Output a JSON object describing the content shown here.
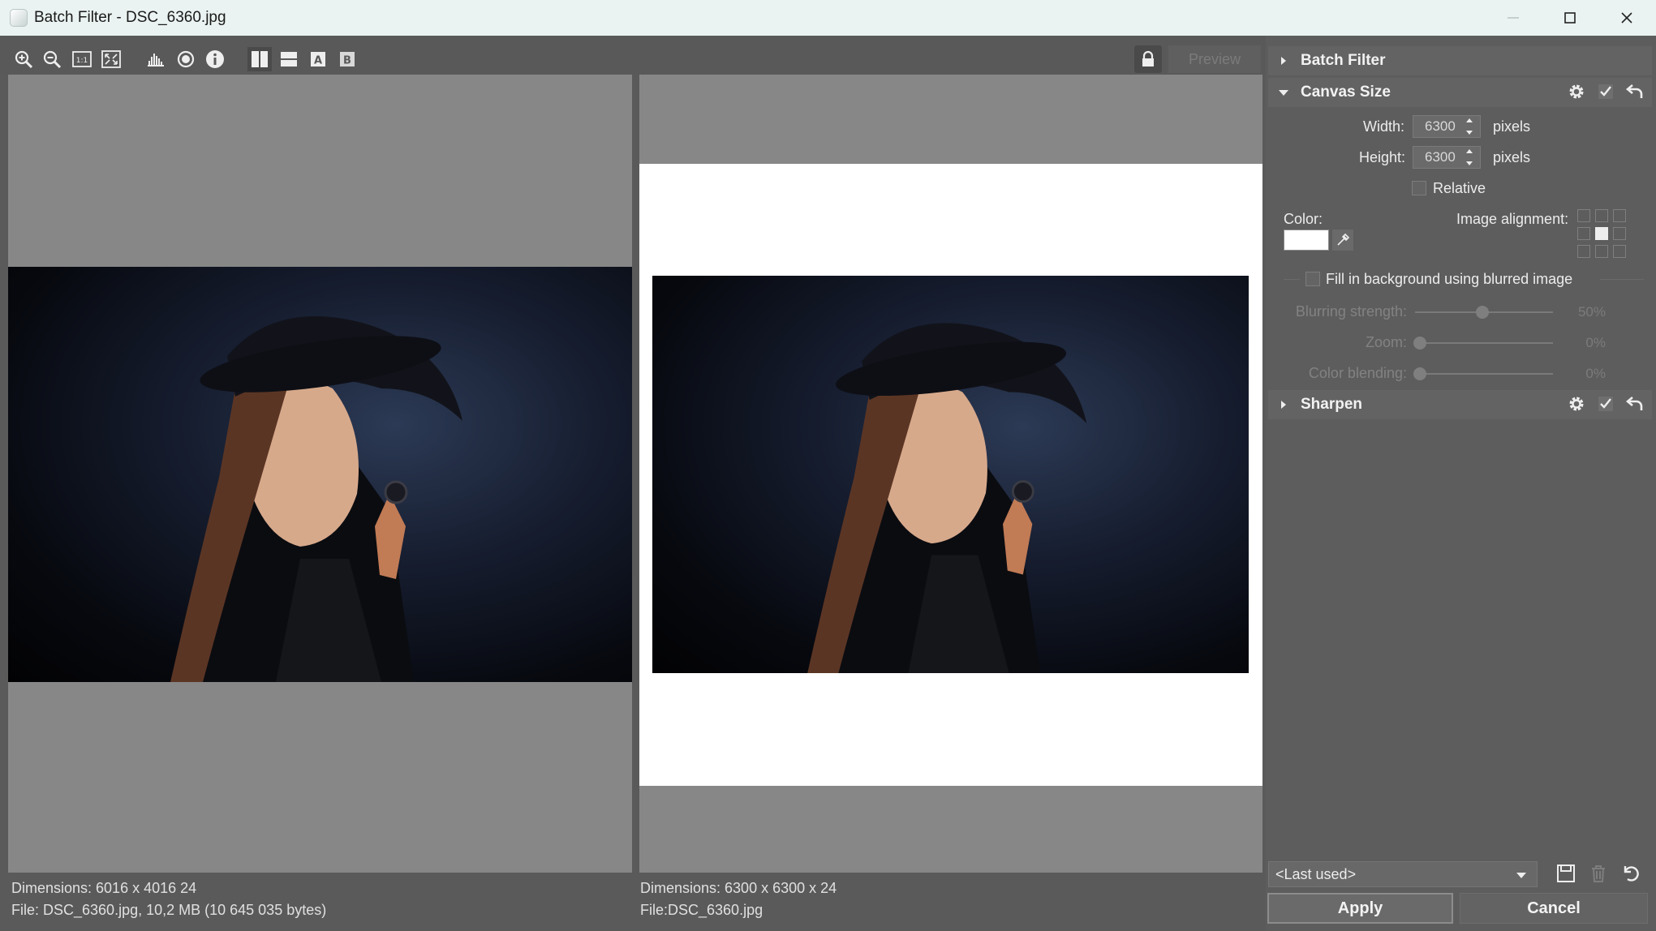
{
  "window": {
    "title": "Batch Filter - DSC_6360.jpg",
    "controls": [
      "minimize-icon",
      "maximize-icon",
      "close-icon"
    ]
  },
  "toolbar": {
    "tools": [
      "zoom-in-icon",
      "zoom-out-icon",
      "zoom-1-1-icon",
      "zoom-fit-icon",
      "histogram-icon",
      "exposure-icon",
      "info-icon",
      "split-vertical-icon",
      "split-horizontal-icon",
      "view-a-icon",
      "view-b-icon"
    ],
    "zoom_1_1_label": "1:1",
    "view_a_label": "A",
    "view_b_label": "B",
    "preview_label": "Preview"
  },
  "left_pane": {
    "dimensions": "Dimensions: 6016 x 4016 24",
    "file": "File: DSC_6360.jpg, 10,2 MB (10 645 035 bytes)"
  },
  "right_pane": {
    "dimensions": "Dimensions: 6300 x 6300 x 24",
    "file": "File:DSC_6360.jpg"
  },
  "panel": {
    "sections": [
      {
        "label": "Batch Filter",
        "expanded": false
      },
      {
        "label": "Canvas Size",
        "expanded": true
      },
      {
        "label": "Sharpen",
        "expanded": false
      }
    ],
    "canvas_size": {
      "width_label": "Width:",
      "width_value": "6300",
      "height_label": "Height:",
      "height_value": "6300",
      "unit": "pixels",
      "relative_label": "Relative",
      "relative_checked": false,
      "color_label": "Color:",
      "color_value": "#ffffff",
      "alignment_label": "Image alignment:",
      "alignment_selected": "center",
      "fill_background_label": "Fill in background using blurred image",
      "fill_background_checked": false,
      "sliders": [
        {
          "label": "Blurring strength:",
          "value": "50%",
          "fraction": 0.5
        },
        {
          "label": "Zoom:",
          "value": "0%",
          "fraction": 0.0
        },
        {
          "label": "Color blending:",
          "value": "0%",
          "fraction": 0.0
        }
      ]
    },
    "preset": "<Last used>",
    "apply_label": "Apply",
    "cancel_label": "Cancel"
  },
  "colors": {
    "panel_bg": "#5d5d5d",
    "image_bg": "#878787",
    "titlebar_bg": "#eaf3f1"
  }
}
